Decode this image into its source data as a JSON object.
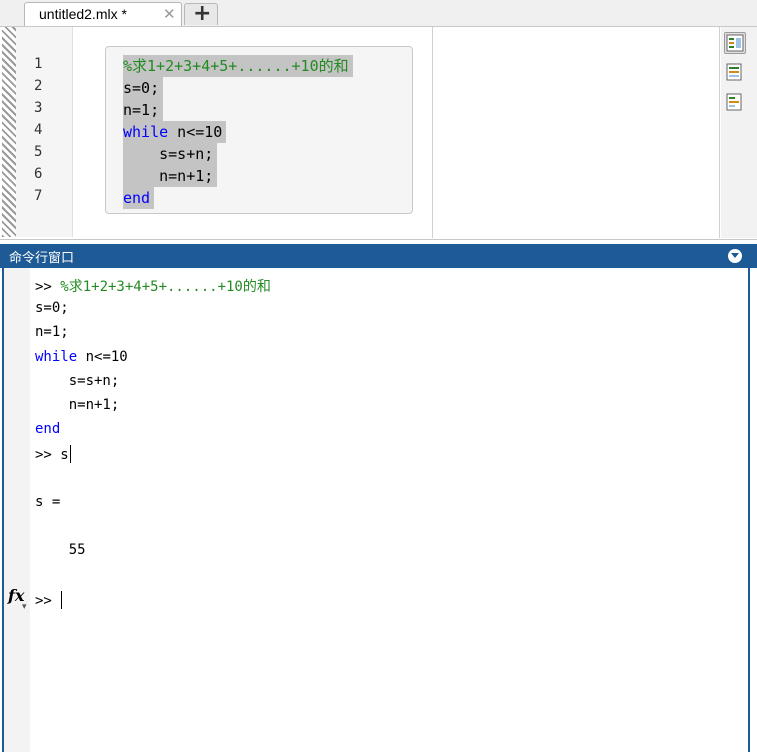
{
  "tab": {
    "title": "untitled2.mlx *",
    "close_glyph": "✕",
    "new_glyph": "+"
  },
  "editor": {
    "line_numbers": [
      "1",
      "2",
      "3",
      "4",
      "5",
      "6",
      "7"
    ],
    "lines": [
      {
        "text": "%求1+2+3+4+5+......+10的和",
        "kind": "comment"
      },
      {
        "text": "s=0;",
        "kind": "plain"
      },
      {
        "text": "n=1;",
        "kind": "plain"
      },
      {
        "keyword": "while",
        "rest": " n<=10",
        "kind": "keyword"
      },
      {
        "text": "    s=s+n;",
        "kind": "plain"
      },
      {
        "text": "    n=n+1;",
        "kind": "plain"
      },
      {
        "text": "end",
        "kind": "kwonly"
      }
    ],
    "tools": [
      "output-inline-icon",
      "output-right-icon",
      "hide-code-icon"
    ]
  },
  "command_window": {
    "title": "命令行窗口",
    "menu_icon": "chevron-down-icon",
    "prompt": ">>",
    "lines": [
      {
        "prompt": ">>",
        "text": " %求1+2+3+4+5+......+10的和",
        "kind": "comment"
      },
      {
        "text": "s=0;",
        "kind": "plain"
      },
      {
        "text": "n=1;",
        "kind": "plain"
      },
      {
        "keyword": "while",
        "rest": " n<=10",
        "kind": "keyword"
      },
      {
        "text": "    s=s+n;",
        "kind": "plain"
      },
      {
        "text": "    n=n+1;",
        "kind": "plain"
      },
      {
        "text": "end",
        "kind": "kwonly"
      },
      {
        "prompt": ">>",
        "text": " s",
        "kind": "plain",
        "caret": true
      },
      {
        "text": "",
        "kind": "plain"
      },
      {
        "text": "s =",
        "kind": "plain"
      },
      {
        "text": "",
        "kind": "plain"
      },
      {
        "text": "    55",
        "kind": "plain"
      },
      {
        "text": "",
        "kind": "plain"
      },
      {
        "prompt": ">>",
        "text": " ",
        "kind": "plain",
        "caret": true
      }
    ],
    "fx_label": "fx"
  }
}
